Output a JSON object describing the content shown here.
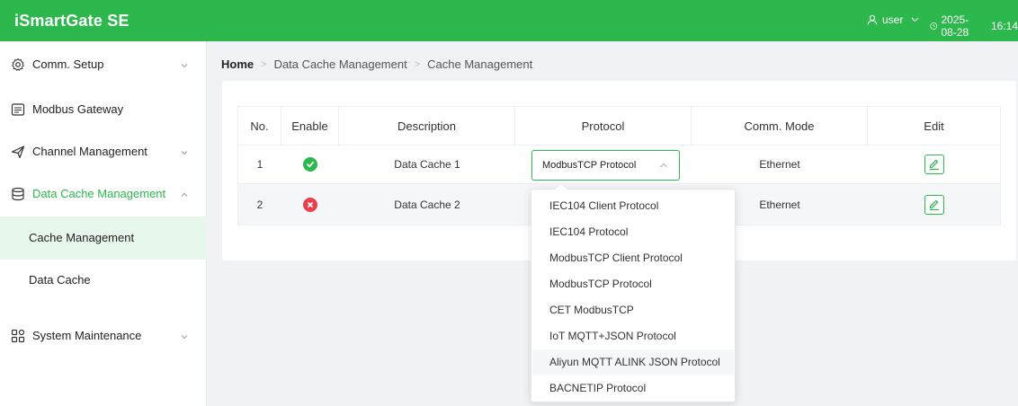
{
  "app": {
    "title": "iSmartGate SE"
  },
  "header": {
    "user": "user",
    "date": "2025-08-28",
    "time": "16:14"
  },
  "sidebar": {
    "items": [
      {
        "label": "Comm. Setup",
        "icon": "gear-icon"
      },
      {
        "label": "Modbus Gateway",
        "icon": "gateway-icon"
      },
      {
        "label": "Channel Management",
        "icon": "send-icon"
      },
      {
        "label": "Data Cache Management",
        "icon": "database-icon",
        "color": "#2db84d"
      },
      {
        "label": "System Maintenance",
        "icon": "grid-icon"
      }
    ],
    "subitems": [
      {
        "label": "Cache Management"
      },
      {
        "label": "Data Cache"
      }
    ]
  },
  "breadcrumb": {
    "home": "Home",
    "level1": "Data Cache Management",
    "level2": "Cache Management"
  },
  "table": {
    "headers": [
      "No.",
      "Enable",
      "Description",
      "Protocol",
      "Comm. Mode",
      "Edit"
    ],
    "rows": [
      {
        "no": "1",
        "enabled": true,
        "description": "Data Cache 1",
        "protocol": "ModbusTCP Protocol",
        "mode": "Ethernet"
      },
      {
        "no": "2",
        "enabled": false,
        "description": "Data Cache 2",
        "protocol": "",
        "mode": "Ethernet"
      }
    ]
  },
  "dropdown": {
    "options": [
      "IEC104 Client Protocol",
      "IEC104 Protocol",
      "ModbusTCP Client Protocol",
      "ModbusTCP Protocol",
      "CET ModbusTCP",
      "IoT MQTT+JSON Protocol",
      "Aliyun MQTT ALINK JSON Protocol",
      "BACNETIP Protocol"
    ],
    "hovered": "Aliyun MQTT ALINK JSON Protocol"
  },
  "colors": {
    "brand": "#2db84d",
    "error": "#e8404d"
  }
}
